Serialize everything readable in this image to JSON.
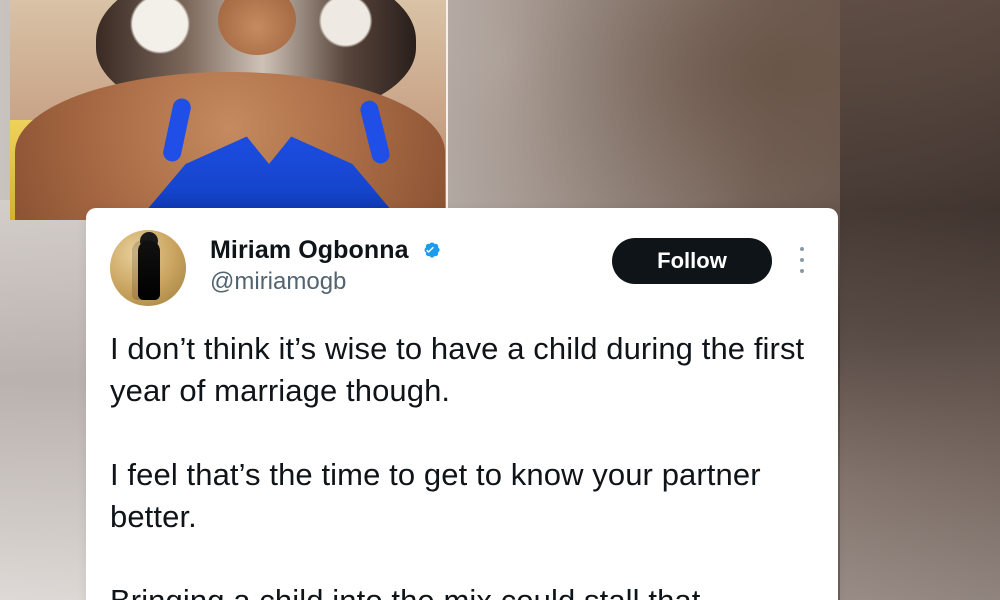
{
  "tweet": {
    "display_name": "Miriam Ogbonna",
    "handle": "@miriamogb",
    "follow_label": "Follow",
    "paragraphs": [
      "I don’t think it’s wise to have a child during the first year of marriage though.",
      "I feel that’s the time to get to know your partner better.",
      "Bringing a child into the mix could stall that"
    ]
  },
  "colors": {
    "card_bg": "#ffffff",
    "text_primary": "#0f1419",
    "text_secondary": "#536471",
    "follow_bg": "#0f1419",
    "follow_text": "#ffffff",
    "verified_blue": "#1d9bf0",
    "swimsuit_blue": "#1f4fe6"
  },
  "icons": {
    "verified": "verified-badge-icon",
    "more": "more-vertical-icon"
  }
}
